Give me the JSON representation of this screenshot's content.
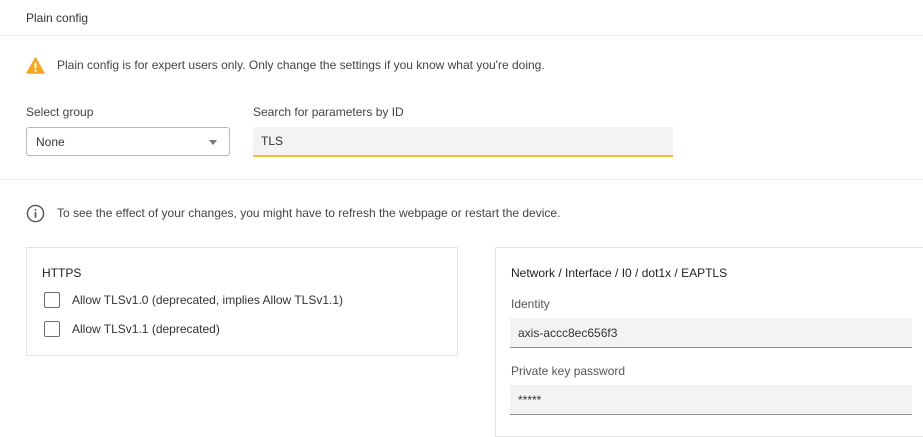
{
  "header": {
    "title": "Plain config"
  },
  "warning": {
    "icon": "warning-triangle-icon",
    "color": "#f5a623",
    "text": "Plain config is for expert users only. Only change the settings if you know what you're doing."
  },
  "filters": {
    "select_group_label": "Select group",
    "select_group_value": "None",
    "search_label": "Search for parameters by ID",
    "search_value": "TLS",
    "search_accent_color": "#f5c12e"
  },
  "info": {
    "icon": "info-circle-icon",
    "text": "To see the effect of your changes, you might have to refresh the webpage or restart the device."
  },
  "https_card": {
    "title": "HTTPS",
    "options": [
      {
        "label": "Allow TLSv1.0 (deprecated, implies Allow TLSv1.1)",
        "checked": false
      },
      {
        "label": "Allow TLSv1.1 (deprecated)",
        "checked": false
      }
    ]
  },
  "eaptls_card": {
    "title": "Network / Interface / I0 / dot1x / EAPTLS",
    "identity_label": "Identity",
    "identity_value": "axis-accc8ec656f3",
    "private_key_label": "Private key password",
    "private_key_value": "*****"
  }
}
